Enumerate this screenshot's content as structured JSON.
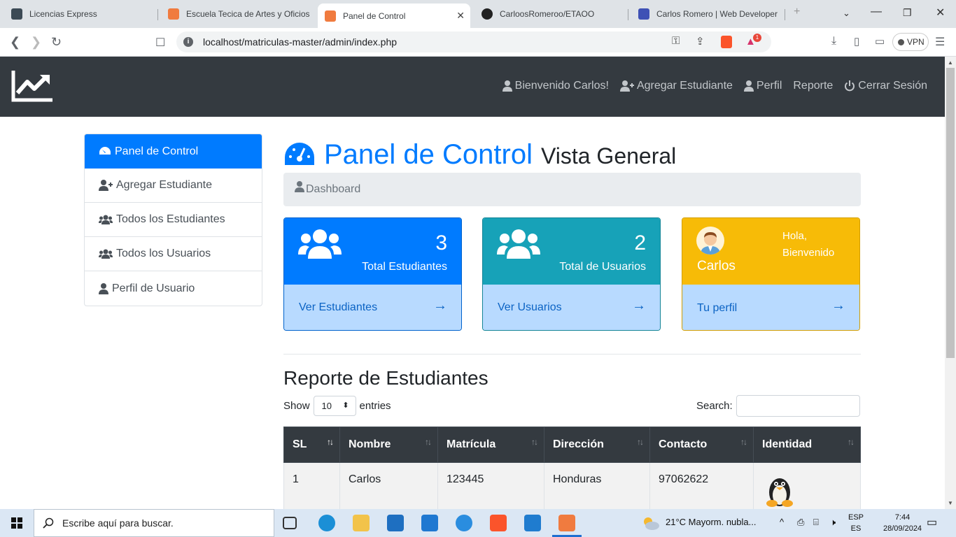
{
  "browser": {
    "tabs": [
      {
        "label": "Licencias Express",
        "active": false
      },
      {
        "label": "Escuela Tecica de Artes y Oficios",
        "active": false
      },
      {
        "label": "Panel de Control",
        "active": true
      },
      {
        "label": "CarloosRomeroo/ETAOO",
        "active": false
      },
      {
        "label": "Carlos Romero | Web Developer",
        "active": false
      }
    ],
    "url": "localhost/matriculas-master/admin/index.php",
    "vpn_label": "VPN",
    "brave_badge": "1"
  },
  "navbar": {
    "links": [
      "Bienvenido Carlos!",
      "Agregar Estudiante",
      "Perfil",
      "Reporte",
      "Cerrar Sesión"
    ]
  },
  "sidebar": {
    "items": [
      {
        "label": "Panel de Control",
        "icon": "tachometer-icon",
        "active": true
      },
      {
        "label": "Agregar Estudiante",
        "icon": "user-plus-icon",
        "active": false
      },
      {
        "label": "Todos los Estudiantes",
        "icon": "users-icon",
        "active": false
      },
      {
        "label": "Todos los Usuarios",
        "icon": "users-icon",
        "active": false
      },
      {
        "label": "Perfil de Usuario",
        "icon": "user-icon",
        "active": false
      }
    ]
  },
  "page": {
    "title": "Panel de Control",
    "subtitle": "Vista General",
    "breadcrumb": "Dashboard"
  },
  "cards": {
    "students": {
      "count": "3",
      "caption": "Total Estudiantes",
      "link": "Ver Estudiantes"
    },
    "users": {
      "count": "2",
      "caption": "Total de Usuarios",
      "link": "Ver Usuarios"
    },
    "profile": {
      "greeting": "Hola, Bienvenido",
      "name": "Carlos",
      "link": "Tu perfil"
    }
  },
  "report": {
    "title": "Reporte de Estudiantes",
    "show_label": "Show",
    "entries_value": "10",
    "entries_label": "entries",
    "search_label": "Search:",
    "columns": [
      "SL",
      "Nombre",
      "Matrícula",
      "Dirección",
      "Contacto",
      "Identidad"
    ],
    "rows": [
      {
        "sl": "1",
        "nombre": "Carlos",
        "matricula": "123445",
        "direccion": "Honduras",
        "contacto": "97062622",
        "identidad": "penguin-avatar"
      }
    ]
  },
  "taskbar": {
    "search_placeholder": "Escribe aquí para buscar.",
    "weather": "21°C  Mayorm. nubla...",
    "lang_top": "ESP",
    "lang_bottom": "ES",
    "time": "7:44",
    "date": "28/09/2024"
  },
  "colors": {
    "primary": "#007bff",
    "info": "#17a2b8",
    "warning": "#f7bb07",
    "dark": "#343a40",
    "card_footer": "#b8daff"
  }
}
